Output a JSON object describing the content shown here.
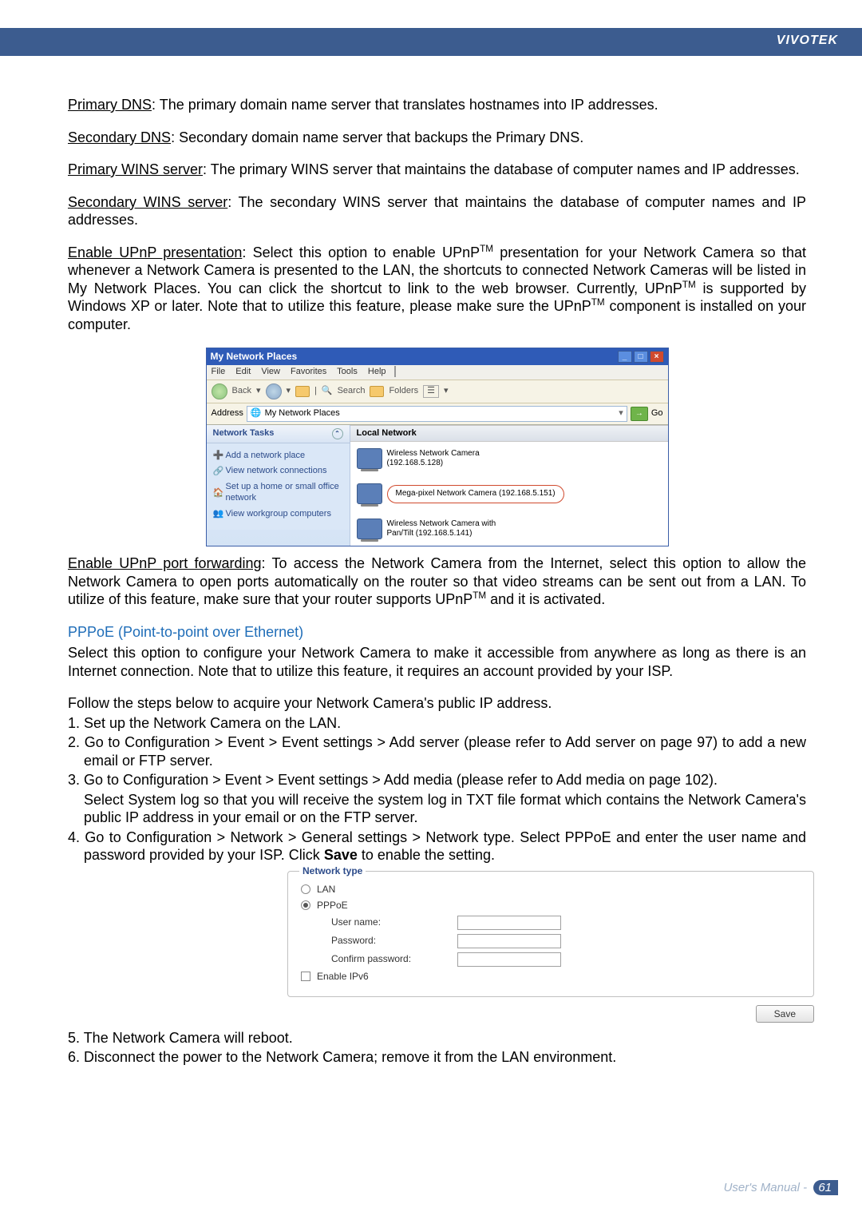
{
  "brand": "VIVOTEK",
  "defs": {
    "primary_dns_label": "Primary DNS",
    "primary_dns_text": ": The primary domain name server that translates hostnames into IP addresses.",
    "secondary_dns_label": "Secondary DNS",
    "secondary_dns_text": ": Secondary domain name server that backups the Primary DNS.",
    "primary_wins_label": "Primary WINS server",
    "primary_wins_text": ": The primary WINS server that maintains the database of computer names and IP addresses.",
    "secondary_wins_label": "Secondary WINS server",
    "secondary_wins_text": ": The secondary WINS server that maintains the database of computer names and IP addresses.",
    "upnp_pres_label": "Enable UPnP presentation",
    "upnp_pres_text_1": ": Select this option to enable UPnP",
    "upnp_pres_text_2": " presentation for your Network Camera so that whenever a Network Camera is presented to the LAN, the shortcuts to connected Network Cameras will be listed in My Network Places. You can click the shortcut to link to the web browser. Currently, UPnP",
    "upnp_pres_text_3": " is supported by Windows XP or later. Note that to utilize this feature, please make sure the UPnP",
    "upnp_pres_text_4": " component is installed on your computer.",
    "upnp_fwd_label": "Enable UPnP port forwarding",
    "upnp_fwd_text_1": ": To access the Network Camera from the Internet, select this option to allow the Network Camera to open ports automatically on the router so that video streams can be sent out from a LAN. To utilize of this feature, make sure that your router supports UPnP",
    "upnp_fwd_text_2": " and it is activated."
  },
  "screenshot1": {
    "title": "My Network Places",
    "menu": [
      "File",
      "Edit",
      "View",
      "Favorites",
      "Tools",
      "Help"
    ],
    "toolbar": {
      "back": "Back",
      "search": "Search",
      "folders": "Folders"
    },
    "addr_label": "Address",
    "addr_value": "My Network Places",
    "go": "Go",
    "side_header": "Network Tasks",
    "side_items": [
      "Add a network place",
      "View network connections",
      "Set up a home or small office network",
      "View workgroup computers"
    ],
    "local_header": "Local Network",
    "cam1": "Wireless Network Camera (192.168.5.128)",
    "cam2": "Wireless Network Camera with Pan/Tilt (192.168.5.141)",
    "callout": "Mega-pixel Network Camera (192.168.5.151)"
  },
  "pppoe": {
    "heading": "PPPoE (Point-to-point over Ethernet)",
    "intro": "Select this option to configure your Network Camera to make it accessible from anywhere as long as there is an Internet connection. Note that to utilize this feature, it requires an account provided by your ISP.",
    "lead": "Follow the steps below to acquire your Network Camera's public IP address.",
    "steps": [
      "1. Set up the Network Camera on the LAN.",
      "2. Go to Configuration > Event > Event settings > Add server (please refer to Add server on page 97) to add a new email or FTP server.",
      "3. Go to Configuration > Event > Event settings > Add media (please refer to Add media on page 102).",
      "Select System log so that you will receive the system log in TXT file format which contains the Network Camera's public IP address in your email or on the FTP server."
    ],
    "step4_a": "4. Go to Configuration > Network > General settings > Network type. Select PPPoE and enter the user name and password provided by your ISP. Click ",
    "step4_bold": "Save",
    "step4_b": " to enable the setting.",
    "post": [
      "5. The Network Camera will reboot.",
      "6. Disconnect the power to the Network Camera; remove it from the LAN environment."
    ]
  },
  "screenshot2": {
    "legend": "Network type",
    "opt_lan": "LAN",
    "opt_pppoe": "PPPoE",
    "user": "User name:",
    "pass": "Password:",
    "confirm": "Confirm password:",
    "ipv6": "Enable IPv6",
    "save": "Save"
  },
  "footer": {
    "label": "User's Manual - ",
    "page": "61"
  },
  "tm": "TM"
}
